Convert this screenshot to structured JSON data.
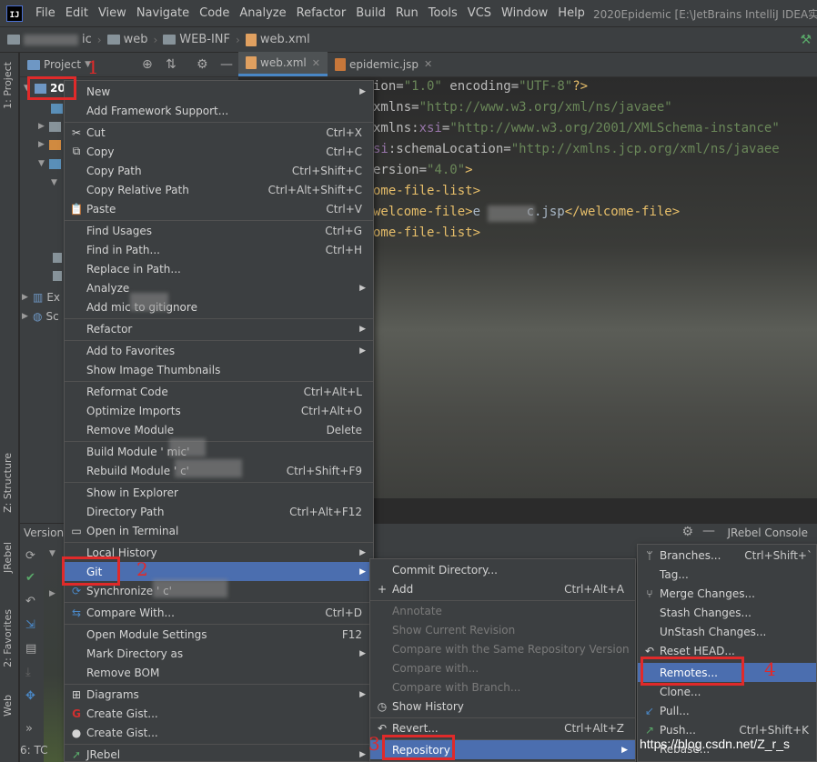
{
  "menubar": {
    "items": [
      "File",
      "Edit",
      "View",
      "Navigate",
      "Code",
      "Analyze",
      "Refactor",
      "Build",
      "Run",
      "Tools",
      "VCS",
      "Window",
      "Help"
    ],
    "window_title": "2020Epidemic [E:\\JetBrains IntelliJ IDEA实例"
  },
  "breadcrumb": {
    "items": [
      "ic",
      "web",
      "WEB-INF",
      "web.xml"
    ]
  },
  "left_stripe": {
    "project": "1: Project",
    "structure": "Z: Structure",
    "jrebel": "JRebel",
    "favorites": "2: Favorites",
    "web": "Web"
  },
  "project_panel": {
    "title": "Project",
    "root": "20",
    "external": "Ex",
    "scratches": "Sc"
  },
  "editor": {
    "tabs": [
      {
        "label": "web.xml"
      },
      {
        "label": "epidemic.jsp"
      }
    ],
    "lines": {
      "l1a": "ion=",
      "l1b": "\"1.0\"",
      "l1c": " encoding=",
      "l1d": "\"UTF-8\"",
      "l1e": "?>",
      "l2a": "xmlns=",
      "l2b": "\"http://www.w3.org/xml/ns/javaee\"",
      "l3a": "xmlns:",
      "l3b": "xsi",
      "l3c": "=",
      "l3d": "\"http://www.w3.org/2001/XMLSchema-instance\"",
      "l4a": "si",
      "l4b": ":schemaLocation=",
      "l4c": "\"http://xmlns.jcp.org/xml/ns/javaee",
      "l5a": "ersion=",
      "l5b": "\"4.0\"",
      "l5c": ">",
      "l6": "ome-file-list>",
      "l7a": "welcome-file>",
      "l7b": "e      c.jsp",
      "l7c": "</",
      "l7d": "welcome-file>",
      "l8": "ome-file-list>"
    }
  },
  "bottom_panel": {
    "version_tab": "Version",
    "jrebel_console": "JRebel Console",
    "status_tab": "6: TC"
  },
  "context_menu": {
    "items": [
      {
        "label": "New",
        "shortcut": ""
      },
      {
        "label": "Add Framework Support...",
        "shortcut": ""
      },
      {
        "label": "Cut",
        "shortcut": "Ctrl+X"
      },
      {
        "label": "Copy",
        "shortcut": "Ctrl+C"
      },
      {
        "label": "Copy Path",
        "shortcut": "Ctrl+Shift+C"
      },
      {
        "label": "Copy Relative Path",
        "shortcut": "Ctrl+Alt+Shift+C"
      },
      {
        "label": "Paste",
        "shortcut": "Ctrl+V"
      },
      {
        "label": "Find Usages",
        "shortcut": "Ctrl+G"
      },
      {
        "label": "Find in Path...",
        "shortcut": "Ctrl+H"
      },
      {
        "label": "Replace in Path...",
        "shortcut": ""
      },
      {
        "label": "Analyze",
        "shortcut": ""
      },
      {
        "label": "Add          mic to gitignore",
        "shortcut": ""
      },
      {
        "label": "Refactor",
        "shortcut": ""
      },
      {
        "label": "Add to Favorites",
        "shortcut": ""
      },
      {
        "label": "Show Image Thumbnails",
        "shortcut": ""
      },
      {
        "label": "Reformat Code",
        "shortcut": "Ctrl+Alt+L"
      },
      {
        "label": "Optimize Imports",
        "shortcut": "Ctrl+Alt+O"
      },
      {
        "label": "Remove Module",
        "shortcut": "Delete"
      },
      {
        "label": "Build Module '          mic'",
        "shortcut": ""
      },
      {
        "label": "Rebuild Module '          c'",
        "shortcut": "Ctrl+Shift+F9"
      },
      {
        "label": "Show in Explorer",
        "shortcut": ""
      },
      {
        "label": "Directory Path",
        "shortcut": "Ctrl+Alt+F12"
      },
      {
        "label": "Open in Terminal",
        "shortcut": ""
      },
      {
        "label": "Local History",
        "shortcut": ""
      },
      {
        "label": "Git",
        "shortcut": ""
      },
      {
        "label": "Synchronize '          c'",
        "shortcut": ""
      },
      {
        "label": "Compare With...",
        "shortcut": "Ctrl+D"
      },
      {
        "label": "Open Module Settings",
        "shortcut": "F12"
      },
      {
        "label": "Mark Directory as",
        "shortcut": ""
      },
      {
        "label": "Remove BOM",
        "shortcut": ""
      },
      {
        "label": "Diagrams",
        "shortcut": ""
      },
      {
        "label": "Create Gist...",
        "shortcut": ""
      },
      {
        "label": "Create Gist...",
        "shortcut": ""
      },
      {
        "label": "JRebel",
        "shortcut": ""
      }
    ]
  },
  "git_menu": {
    "items": [
      {
        "label": "Commit Directory...",
        "shortcut": ""
      },
      {
        "label": "Add",
        "shortcut": "Ctrl+Alt+A"
      },
      {
        "label": "Annotate",
        "shortcut": ""
      },
      {
        "label": "Show Current Revision",
        "shortcut": ""
      },
      {
        "label": "Compare with the Same Repository Version",
        "shortcut": ""
      },
      {
        "label": "Compare with...",
        "shortcut": ""
      },
      {
        "label": "Compare with Branch...",
        "shortcut": ""
      },
      {
        "label": "Show History",
        "shortcut": ""
      },
      {
        "label": "Revert...",
        "shortcut": "Ctrl+Alt+Z"
      },
      {
        "label": "Repository",
        "shortcut": ""
      }
    ]
  },
  "repository_menu": {
    "items": [
      {
        "label": "Branches...",
        "shortcut": "Ctrl+Shift+`"
      },
      {
        "label": "Tag...",
        "shortcut": ""
      },
      {
        "label": "Merge Changes...",
        "shortcut": ""
      },
      {
        "label": "Stash Changes...",
        "shortcut": ""
      },
      {
        "label": "UnStash Changes...",
        "shortcut": ""
      },
      {
        "label": "Reset HEAD...",
        "shortcut": ""
      },
      {
        "label": "Remotes...",
        "shortcut": ""
      },
      {
        "label": "Clone...",
        "shortcut": ""
      },
      {
        "label": "Pull...",
        "shortcut": ""
      },
      {
        "label": "Push...",
        "shortcut": "Ctrl+Shift+K"
      },
      {
        "label": "Rebase...",
        "shortcut": ""
      }
    ]
  },
  "annotations": {
    "n1": "1",
    "n2": "2",
    "n3": "3",
    "n4": "4"
  },
  "watermark": "https://blog.csdn.net/Z_r_s",
  "colors": {
    "selection": "#4b6eaf",
    "annotation": "#e02a2a",
    "menu_bg": "#3c3f41"
  }
}
